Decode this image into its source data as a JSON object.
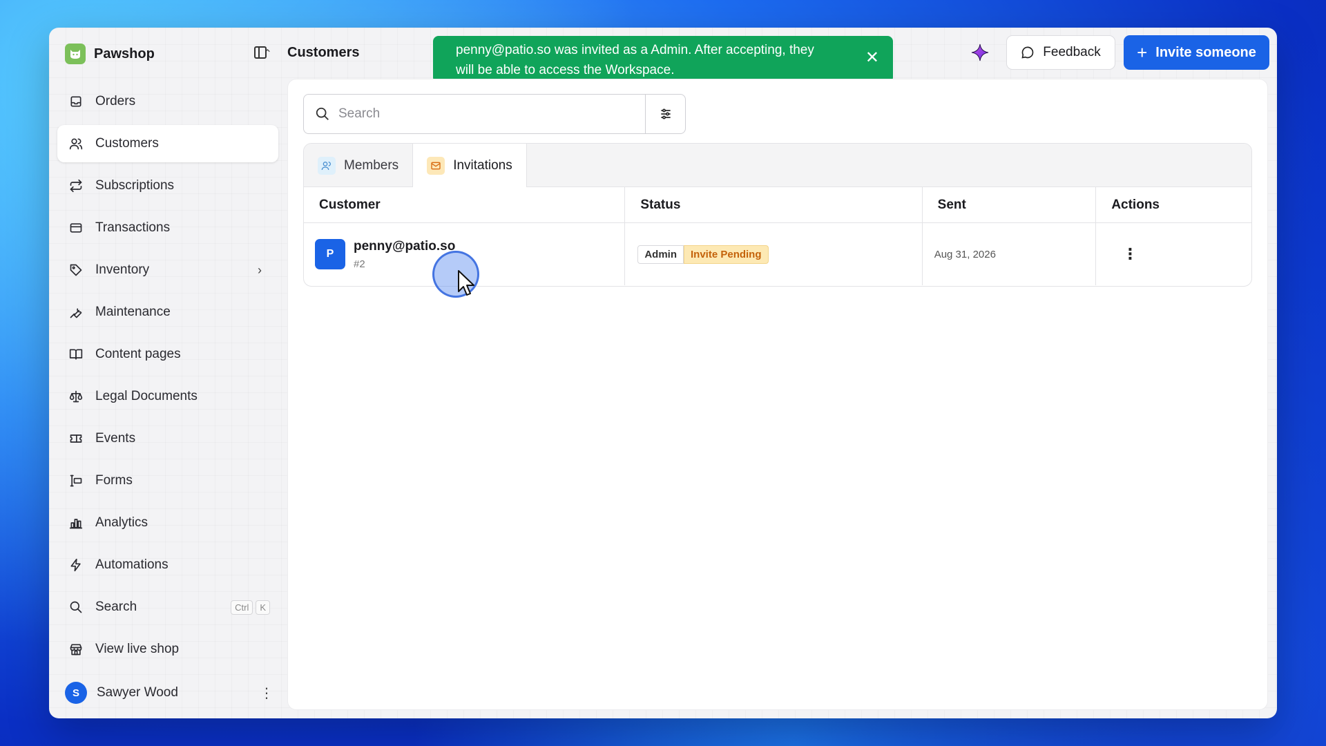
{
  "workspace": {
    "name": "Pawshop"
  },
  "page": {
    "title": "Customers"
  },
  "toast": {
    "message": "penny@patio.so was invited as a Admin. After accepting, they will be able to access the Workspace."
  },
  "header": {
    "feedback_label": "Feedback",
    "invite_label": "Invite someone"
  },
  "sidebar": {
    "items": [
      {
        "label": "Orders",
        "icon": "inbox-icon"
      },
      {
        "label": "Customers",
        "icon": "users-icon",
        "active": true
      },
      {
        "label": "Subscriptions",
        "icon": "repeat-icon"
      },
      {
        "label": "Transactions",
        "icon": "credit-card-icon"
      },
      {
        "label": "Inventory",
        "icon": "tag-icon",
        "has_chevron": true
      },
      {
        "label": "Maintenance",
        "icon": "wrench-icon"
      },
      {
        "label": "Content pages",
        "icon": "book-icon"
      },
      {
        "label": "Legal Documents",
        "icon": "scale-icon"
      },
      {
        "label": "Events",
        "icon": "ticket-icon"
      },
      {
        "label": "Forms",
        "icon": "form-icon"
      },
      {
        "label": "Analytics",
        "icon": "bar-chart-icon"
      },
      {
        "label": "Automations",
        "icon": "bolt-icon"
      }
    ],
    "search": {
      "label": "Search",
      "shortcut_1": "Ctrl",
      "shortcut_2": "K"
    },
    "live_shop": {
      "label": "View live shop"
    },
    "user": {
      "initial": "S",
      "name": "Sawyer Wood"
    }
  },
  "search": {
    "placeholder": "Search"
  },
  "tabs": [
    {
      "label": "Members"
    },
    {
      "label": "Invitations",
      "active": true
    }
  ],
  "table": {
    "columns": [
      "Customer",
      "Status",
      "Sent",
      "Actions"
    ],
    "rows": [
      {
        "initial": "P",
        "email": "penny@patio.so",
        "id": "#2",
        "role": "Admin",
        "status": "Invite Pending",
        "sent": "Aug 31, 2026"
      }
    ]
  },
  "colors": {
    "accent": "#1a63e6",
    "toast_bg": "#10a45a",
    "pending_bg": "#fde9b4",
    "pending_text": "#c4620a",
    "workspace_logo": "#7cc05a"
  }
}
